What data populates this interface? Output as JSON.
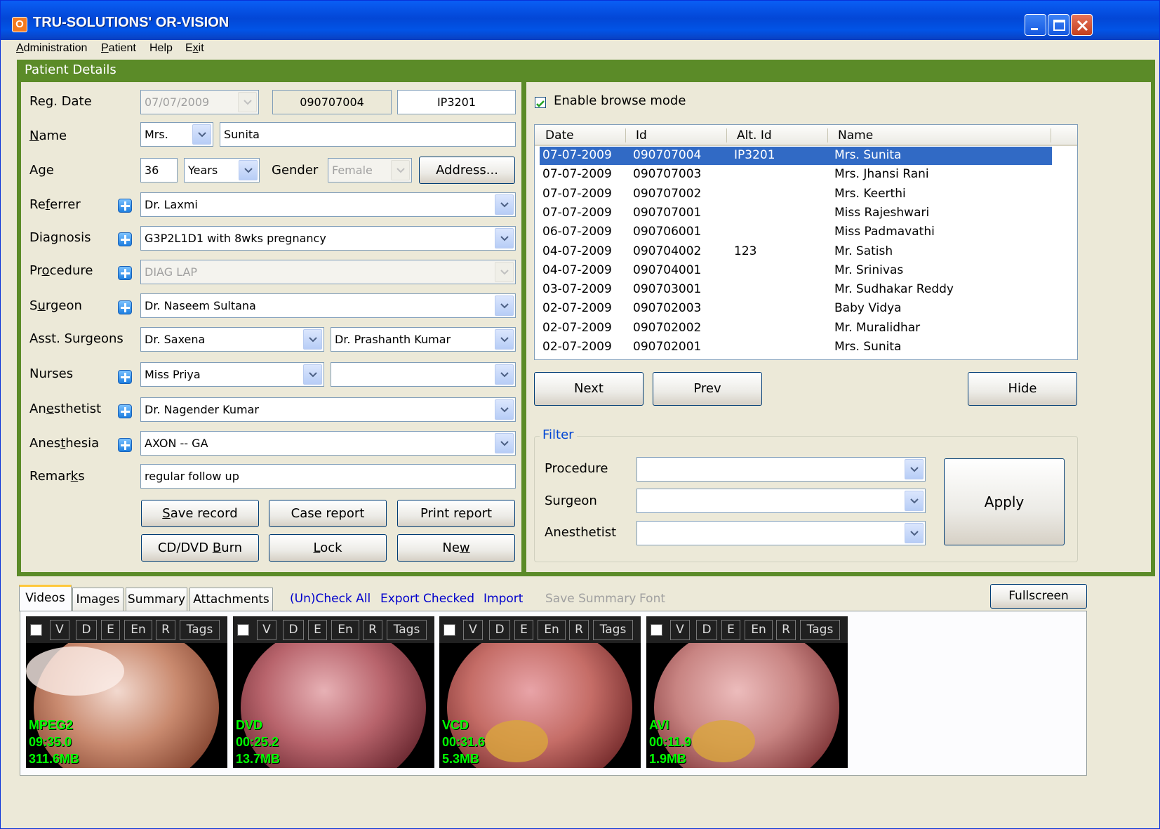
{
  "app": {
    "title": "TRU-SOLUTIONS' OR-VISION",
    "icon": "app-icon"
  },
  "menu": [
    "Administration",
    "Patient",
    "Help",
    "Exit"
  ],
  "panel_title": "Patient Details",
  "form": {
    "labels": {
      "reg_date": "Reg. Date",
      "name": "Name",
      "age": "Age",
      "gender": "Gender",
      "referrer": "Referrer",
      "diagnosis": "Diagnosis",
      "procedure": "Procedure",
      "surgeon": "Surgeon",
      "asst_surgeons": "Asst. Surgeons",
      "nurses": "Nurses",
      "anesthetist": "Anesthetist",
      "anesthesia": "Anesthesia",
      "remarks": "Remarks"
    },
    "reg_date": "07/07/2009",
    "reg_id": "090707004",
    "alt_id": "IP3201",
    "title_prefix": "Mrs.",
    "name": "Sunita",
    "age": "36",
    "age_unit": "Years",
    "gender": "Female",
    "address_button": "Address...",
    "referrer": "Dr. Laxmi",
    "diagnosis": "G3P2L1D1 with 8wks pregnancy",
    "procedure": "DIAG LAP",
    "surgeon": "Dr. Naseem Sultana",
    "asst_surgeon_1": "Dr. Saxena",
    "asst_surgeon_2": "Dr. Prashanth Kumar",
    "nurse_1": "Miss Priya",
    "nurse_2": "",
    "anesthetist": "Dr. Nagender Kumar",
    "anesthesia": "AXON -- GA",
    "remarks": "regular follow up",
    "buttons": {
      "save": "Save record",
      "case": "Case report",
      "print": "Print report",
      "burn": "CD/DVD Burn",
      "lock": "Lock",
      "new": "New"
    }
  },
  "browse": {
    "enable_label": "Enable browse mode",
    "enabled": true,
    "columns": [
      "Date",
      "Id",
      "Alt. Id",
      "Name"
    ],
    "rows": [
      [
        "07-07-2009",
        "090707004",
        "IP3201",
        "Mrs. Sunita"
      ],
      [
        "07-07-2009",
        "090707003",
        "",
        "Mrs. Jhansi Rani"
      ],
      [
        "07-07-2009",
        "090707002",
        "",
        "Mrs. Keerthi"
      ],
      [
        "07-07-2009",
        "090707001",
        "",
        "Miss Rajeshwari"
      ],
      [
        "06-07-2009",
        "090706001",
        "",
        "Miss Padmavathi"
      ],
      [
        "04-07-2009",
        "090704002",
        "123",
        "Mr. Satish"
      ],
      [
        "04-07-2009",
        "090704001",
        "",
        "Mr. Srinivas"
      ],
      [
        "03-07-2009",
        "090703001",
        "",
        "Mr. Sudhakar Reddy"
      ],
      [
        "02-07-2009",
        "090702003",
        "",
        "Baby Vidya"
      ],
      [
        "02-07-2009",
        "090702002",
        "",
        "Mr. Muralidhar"
      ],
      [
        "02-07-2009",
        "090702001",
        "",
        "Mrs. Sunita"
      ]
    ],
    "next": "Next",
    "prev": "Prev",
    "hide": "Hide"
  },
  "filter": {
    "title": "Filter",
    "procedure_label": "Procedure",
    "surgeon_label": "Surgeon",
    "anesthetist_label": "Anesthetist",
    "procedure": "",
    "surgeon": "",
    "anesthetist": "",
    "apply": "Apply"
  },
  "media": {
    "tabs": [
      "Videos",
      "Images",
      "Summary",
      "Attachments"
    ],
    "links": [
      "(Un)Check All",
      "Export Checked",
      "Import"
    ],
    "disabled_links": [
      "Save Summary",
      "Font"
    ],
    "fullscreen": "Fullscreen",
    "thumb_buttons": [
      "V",
      "D",
      "E",
      "En",
      "R",
      "Tags"
    ],
    "videos": [
      {
        "format": "MPEG2",
        "duration": "09:35.0",
        "size": "311.6MB"
      },
      {
        "format": "DVD",
        "duration": "00:25.2",
        "size": "13.7MB"
      },
      {
        "format": "VCD",
        "duration": "00:31.6",
        "size": "5.3MB"
      },
      {
        "format": "AVI",
        "duration": "00:11.9",
        "size": "1.9MB"
      }
    ]
  },
  "colors": {
    "title_bar": "#0a5ef5",
    "panel_frame": "#5b8b28",
    "selection": "#316ac5",
    "video_info": "#00ff00"
  }
}
